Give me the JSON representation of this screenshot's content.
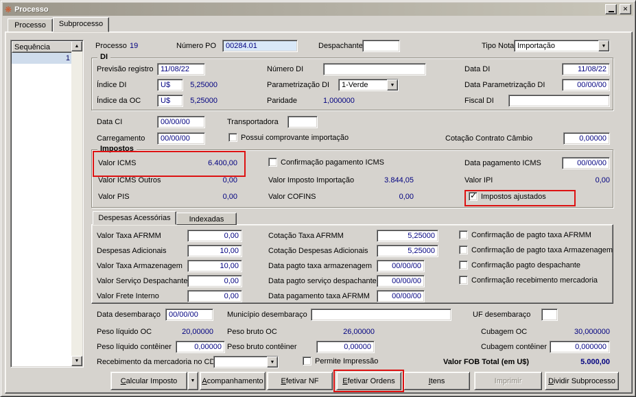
{
  "colors": {
    "value_text": "#000080",
    "annotation": "#dd1111",
    "field_highlight": "#d9e8f8",
    "window_bg": "#d6d3ce"
  },
  "icons": {
    "app": "❋",
    "minimize": "minimize-dash",
    "close": "✕",
    "dropdown_arrow": "▼",
    "scroll_up": "▲",
    "scroll_down": "▼"
  },
  "titlebar": {
    "title": "Processo"
  },
  "tabs": {
    "processo": "Processo",
    "subprocesso": "Subprocesso"
  },
  "sequence": {
    "header": "Sequência",
    "selected_row": "1"
  },
  "top": {
    "processo_label": "Processo",
    "processo_value": "19",
    "numero_po_label": "Número PO",
    "numero_po_value": "00284.01",
    "despachante_label": "Despachante",
    "despachante_value": "",
    "tipo_nota_label": "Tipo Nota",
    "tipo_nota_value": "Importação"
  },
  "di": {
    "title": "DI",
    "previsao_registro_label": "Previsão registro",
    "previsao_registro_value": "11/08/22",
    "numero_di_label": "Número DI",
    "numero_di_value": "",
    "data_di_label": "Data DI",
    "data_di_value": "11/08/22",
    "indice_di_label": "Índice DI",
    "indice_di_currency": "U$",
    "indice_di_value": "5,25000",
    "parametrizacao_di_label": "Parametrização DI",
    "parametrizacao_di_value": "1-Verde",
    "data_parametrizacao_di_label": "Data Parametrização DI",
    "data_parametrizacao_di_value": "00/00/00",
    "indice_oc_label": "Índice da OC",
    "indice_oc_currency": "U$",
    "indice_oc_value": "5,25000",
    "paridade_label": "Paridade",
    "paridade_value": "1,000000",
    "fiscal_di_label": "Fiscal DI",
    "fiscal_di_value": ""
  },
  "ci_row": {
    "data_ci_label": "Data CI",
    "data_ci_value": "00/00/00",
    "transportadora_label": "Transportadora",
    "transportadora_value": "",
    "carregamento_label": "Carregamento",
    "carregamento_value": "00/00/00",
    "possui_comprovante_label": "Possui comprovante importação",
    "possui_comprovante_checked": false,
    "cotacao_contrato_cambio_label": "Cotação Contrato Câmbio",
    "cotacao_contrato_cambio_value": "0,00000"
  },
  "impostos": {
    "title": "Impostos",
    "valor_icms_label": "Valor ICMS",
    "valor_icms_value": "6.400,00",
    "confirmacao_pagamento_icms_label": "Confirmação pagamento ICMS",
    "confirmacao_pagamento_icms_checked": false,
    "data_pagamento_icms_label": "Data pagamento ICMS",
    "data_pagamento_icms_value": "00/00/00",
    "valor_icms_outros_label": "Valor ICMS Outros",
    "valor_icms_outros_value": "0,00",
    "valor_imposto_importacao_label": "Valor Imposto Importação",
    "valor_imposto_importacao_value": "3.844,05",
    "valor_ipi_label": "Valor IPI",
    "valor_ipi_value": "0,00",
    "valor_pis_label": "Valor PIS",
    "valor_pis_value": "0,00",
    "valor_cofins_label": "Valor COFINS",
    "valor_cofins_value": "0,00",
    "impostos_ajustados_label": "Impostos ajustados",
    "impostos_ajustados_checked": true
  },
  "despesas": {
    "tab_despesas": "Despesas Acessórias",
    "tab_indexadas": "Indexadas",
    "valor_taxa_afrmm_label": "Valor Taxa AFRMM",
    "valor_taxa_afrmm_value": "0,00",
    "cotacao_taxa_afrmm_label": "Cotação Taxa AFRMM",
    "cotacao_taxa_afrmm_value": "5,25000",
    "conf_pagto_taxa_afrmm_label": "Confirmação de pagto taxa AFRMM",
    "conf_pagto_taxa_afrmm_checked": false,
    "despesas_adicionais_label": "Despesas Adicionais",
    "despesas_adicionais_value": "10,00",
    "cotacao_despesas_adicionais_label": "Cotação Despesas Adicionais",
    "cotacao_despesas_adicionais_value": "5,25000",
    "conf_pagto_taxa_armazenagem_label": "Confirmação de pagto taxa Armazenagem",
    "conf_pagto_taxa_armazenagem_checked": false,
    "valor_taxa_armazenagem_label": "Valor Taxa Armazenagem",
    "valor_taxa_armazenagem_value": "10,00",
    "data_pagto_taxa_armazenagem_label": "Data pagto taxa armazenagem",
    "data_pagto_taxa_armazenagem_value": "00/00/00",
    "conf_pagto_despachante_label": "Confirmação pagto despachante",
    "conf_pagto_despachante_checked": false,
    "valor_servico_despachante_label": "Valor Serviço Despachante",
    "valor_servico_despachante_value": "0,00",
    "data_pagto_servico_despachante_label": "Data pagto serviço despachante",
    "data_pagto_servico_despachante_value": "00/00/00",
    "conf_recebimento_mercadoria_label": "Confirmação recebimento mercadoria",
    "conf_recebimento_mercadoria_checked": false,
    "valor_frete_interno_label": "Valor Frete Interno",
    "valor_frete_interno_value": "0,00",
    "data_pagamento_taxa_afrmm_label": "Data pagamento taxa AFRMM",
    "data_pagamento_taxa_afrmm_value": "00/00/00"
  },
  "desembaraco": {
    "data_label": "Data desembaraço",
    "data_value": "00/00/00",
    "municipio_label": "Município desembaraço",
    "municipio_value": "",
    "uf_label": "UF desembaraço",
    "uf_value": ""
  },
  "pesos": {
    "peso_liquido_oc_label": "Peso líquido OC",
    "peso_liquido_oc_value": "20,00000",
    "peso_bruto_oc_label": "Peso bruto OC",
    "peso_bruto_oc_value": "26,00000",
    "cubagem_oc_label": "Cubagem OC",
    "cubagem_oc_value": "30,000000",
    "peso_liquido_conteiner_label": "Peso líquido contêiner",
    "peso_liquido_conteiner_value": "0,00000",
    "peso_bruto_conteiner_label": "Peso bruto contêiner",
    "peso_bruto_conteiner_value": "0,00000",
    "cubagem_conteiner_label": "Cubagem contêiner",
    "cubagem_conteiner_value": "0,000000"
  },
  "footer": {
    "recebimento_cd_label": "Recebimento da mercadoria no CD",
    "recebimento_cd_value": "",
    "permite_impressao_label": "Permite Impressão",
    "permite_impressao_checked": false,
    "valor_fob_label": "Valor FOB Total (em U$)",
    "valor_fob_value": "5.000,00"
  },
  "buttons": [
    {
      "label": "Calcular Imposto"
    },
    {
      "label": "Acompanhamento"
    },
    {
      "label": "Efetivar NF"
    },
    {
      "label": "Efetivar Ordens"
    },
    {
      "label": "Itens"
    },
    {
      "label": "Imprimir"
    },
    {
      "label": "Dividir Subprocesso"
    }
  ]
}
